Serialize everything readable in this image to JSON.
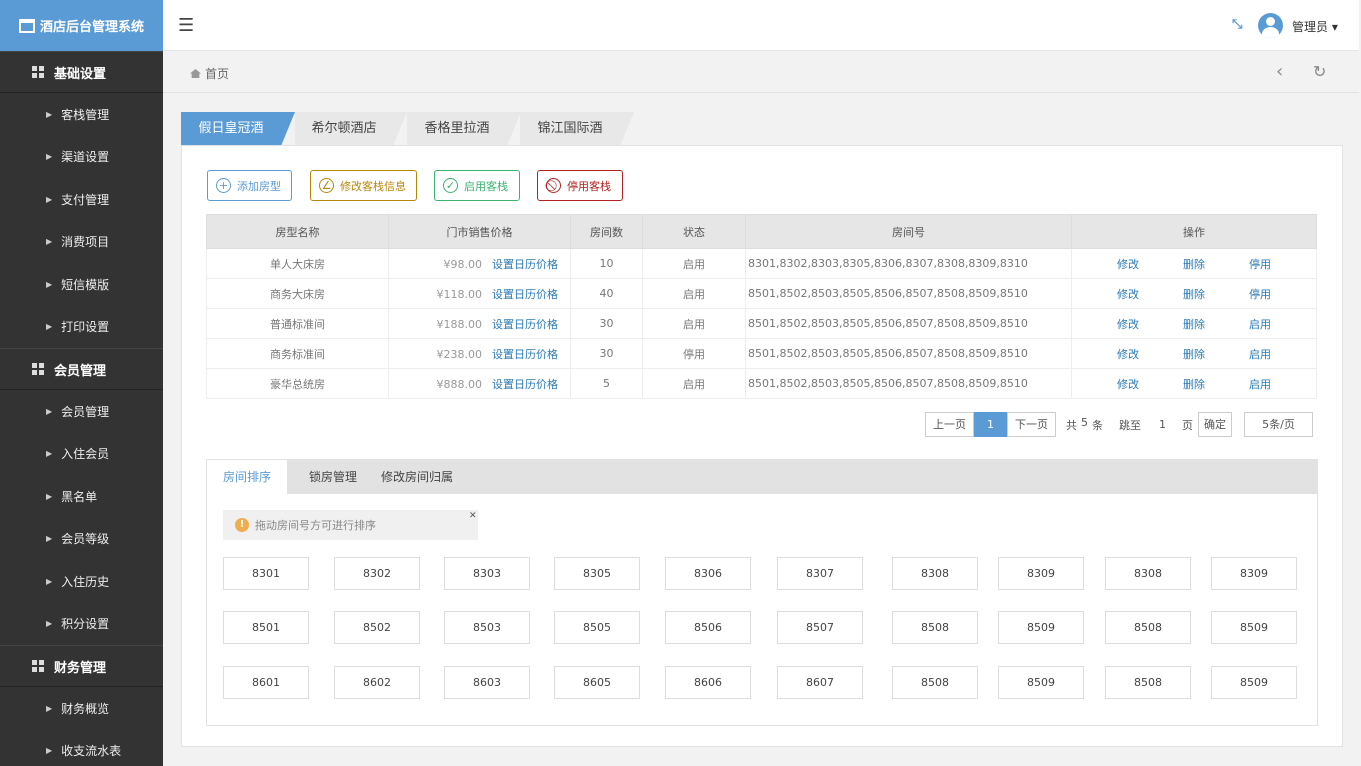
{
  "app_title": "酒店后台管理系统",
  "sidebar": [
    {
      "section": "基础设置",
      "items": [
        "客栈管理",
        "渠道设置",
        "支付管理",
        "消费项目",
        "短信模版",
        "打印设置"
      ]
    },
    {
      "section": "会员管理",
      "items": [
        "会员管理",
        "入住会员",
        "黑名单",
        "会员等级",
        "入住历史",
        "积分设置"
      ]
    },
    {
      "section": "财务管理",
      "items": [
        "财务概览",
        "收支流水表"
      ]
    }
  ],
  "topbar": {
    "menu_icon": "☰",
    "user": "管理员 ▾"
  },
  "breadcrumb": "首页",
  "hotel_tabs": [
    "假日皇冠酒店",
    "希尔顿酒店",
    "香格里拉酒店",
    "锦江国际酒店"
  ],
  "actions": [
    {
      "label": "添加房型",
      "icon": "+",
      "color": "#5b9bd5"
    },
    {
      "label": "修改客栈信息",
      "icon": "∠",
      "color": "#b8860b"
    },
    {
      "label": "启用客栈",
      "icon": "✓",
      "color": "#3cb371"
    },
    {
      "label": "停用客栈",
      "icon": "⃠",
      "color": "#b22222"
    }
  ],
  "table": {
    "headers": [
      "房型名称",
      "门市销售价格",
      "房间数",
      "状态",
      "房间号",
      "操作"
    ],
    "set_price_label": "设置日历价格",
    "rows": [
      {
        "name": "单人大床房",
        "price": "¥98.00",
        "count": "10",
        "status": "启用",
        "rooms": "8301,8302,8303,8305,8306,8307,8308,8309,8310",
        "ops": [
          "修改",
          "删除",
          "停用"
        ]
      },
      {
        "name": "商务大床房",
        "price": "¥118.00",
        "count": "40",
        "status": "启用",
        "rooms": "8501,8502,8503,8505,8506,8507,8508,8509,8510",
        "ops": [
          "修改",
          "删除",
          "停用"
        ]
      },
      {
        "name": "普通标准间",
        "price": "¥188.00",
        "count": "30",
        "status": "启用",
        "rooms": "8501,8502,8503,8505,8506,8507,8508,8509,8510",
        "ops": [
          "修改",
          "删除",
          "启用"
        ]
      },
      {
        "name": "商务标准间",
        "price": "¥238.00",
        "count": "30",
        "status": "停用",
        "rooms": "8501,8502,8503,8505,8506,8507,8508,8509,8510",
        "ops": [
          "修改",
          "删除",
          "启用"
        ]
      },
      {
        "name": "豪华总统房",
        "price": "¥888.00",
        "count": "5",
        "status": "启用",
        "rooms": "8501,8502,8503,8505,8506,8507,8508,8509,8510",
        "ops": [
          "修改",
          "删除",
          "启用"
        ]
      }
    ]
  },
  "pager": {
    "prev": "上一页",
    "current": "1",
    "next": "下一页",
    "total_prefix": "共",
    "total": "5",
    "total_suffix": "条",
    "jump_prefix": "跳至",
    "jump_value": "1",
    "jump_suffix": "页",
    "confirm": "确定",
    "page_size": "5条/页"
  },
  "lower_tabs": [
    "房间排序",
    "锁房管理",
    "修改房间归属"
  ],
  "notice": "拖动房间号方可进行排序",
  "room_grid": [
    [
      "8301",
      "8302",
      "8303",
      "8305",
      "8306",
      "8307",
      "8308",
      "8309",
      "8308",
      "8309"
    ],
    [
      "8501",
      "8502",
      "8503",
      "8505",
      "8506",
      "8507",
      "8508",
      "8509",
      "8508",
      "8509"
    ],
    [
      "8601",
      "8602",
      "8603",
      "8605",
      "8606",
      "8607",
      "8508",
      "8509",
      "8508",
      "8509"
    ]
  ]
}
